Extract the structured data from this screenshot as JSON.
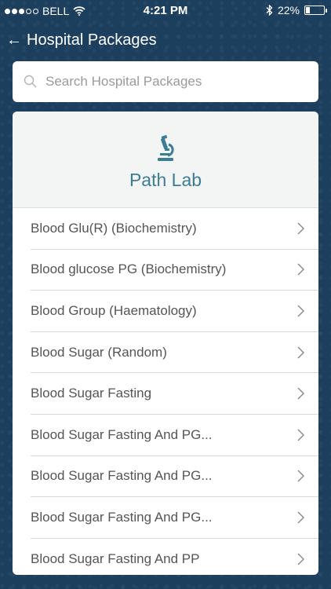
{
  "status_bar": {
    "carrier": "BELL",
    "time": "4:21 PM",
    "battery": "22%",
    "battery_level": 0.22,
    "signal": {
      "filled": 3,
      "total": 5
    }
  },
  "nav": {
    "back_icon": "back-arrow-icon",
    "title": "Hospital Packages"
  },
  "search": {
    "placeholder": "Search Hospital Packages",
    "value": ""
  },
  "section": {
    "icon": "microscope-icon",
    "title": "Path Lab",
    "accent_color": "#3d7d94"
  },
  "packages": [
    "Blood Glu(R) (Biochemistry)",
    "Blood glucose PG (Biochemistry)",
    "Blood Group (Haematology)",
    "Blood Sugar (Random)",
    "Blood Sugar Fasting",
    "Blood Sugar Fasting And PG...",
    "Blood Sugar Fasting And PG...",
    "Blood Sugar Fasting And PG...",
    "Blood Sugar Fasting And PP"
  ]
}
